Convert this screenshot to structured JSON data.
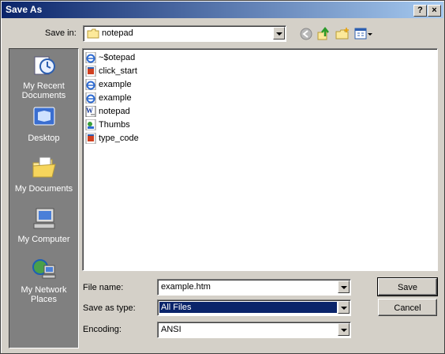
{
  "window": {
    "title": "Save As"
  },
  "title_buttons": {
    "help": "?",
    "close": "×"
  },
  "save_in": {
    "label": "Save in:",
    "value": "notepad"
  },
  "places": [
    {
      "label": "My Recent Documents",
      "icon": "recent-documents-icon"
    },
    {
      "label": "Desktop",
      "icon": "desktop-icon"
    },
    {
      "label": "My Documents",
      "icon": "my-documents-icon"
    },
    {
      "label": "My Computer",
      "icon": "my-computer-icon"
    },
    {
      "label": "My Network Places",
      "icon": "network-places-icon"
    }
  ],
  "files": [
    {
      "name": "~$otepad",
      "icon": "ie-html-icon"
    },
    {
      "name": "click_start",
      "icon": "app-icon"
    },
    {
      "name": "example",
      "icon": "ie-html-icon"
    },
    {
      "name": "example",
      "icon": "ie-html-icon"
    },
    {
      "name": "notepad",
      "icon": "word-doc-icon"
    },
    {
      "name": "Thumbs",
      "icon": "image-db-icon"
    },
    {
      "name": "type_code",
      "icon": "app-icon"
    }
  ],
  "form": {
    "filename_label": "File name:",
    "filename_value": "example.htm",
    "type_label": "Save as type:",
    "type_value": "All Files",
    "encoding_label": "Encoding:",
    "encoding_value": "ANSI"
  },
  "buttons": {
    "save": "Save",
    "cancel": "Cancel"
  }
}
